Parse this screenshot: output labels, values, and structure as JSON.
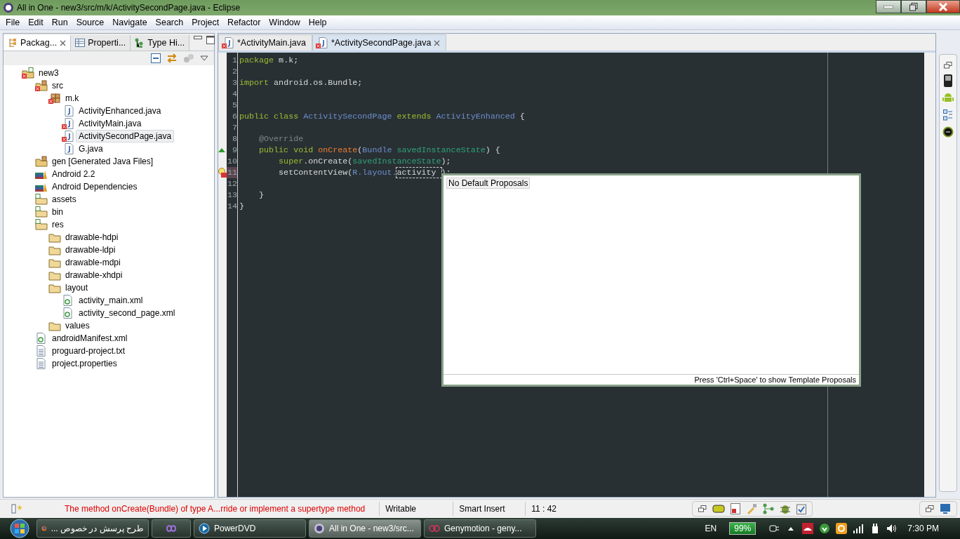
{
  "window": {
    "title": "All in One - new3/src/m/k/ActivitySecondPage.java - Eclipse"
  },
  "menu": [
    "File",
    "Edit",
    "Run",
    "Source",
    "Navigate",
    "Search",
    "Project",
    "Refactor",
    "Window",
    "Help"
  ],
  "left_panel": {
    "tabs": [
      {
        "label": "Packag...",
        "selected": true,
        "kind": "package"
      },
      {
        "label": "Properti...",
        "selected": false,
        "kind": "table"
      },
      {
        "label": "Type Hi...",
        "selected": false,
        "kind": "hierarchy"
      }
    ],
    "tree": [
      {
        "label": "new3",
        "kind": "project",
        "error": true,
        "selected": false,
        "children": [
          {
            "label": "src",
            "kind": "source",
            "error": true,
            "selected": false,
            "children": [
              {
                "label": "m.k",
                "kind": "package",
                "error": true,
                "selected": false,
                "children": [
                  {
                    "label": "ActivityEnhanced.java",
                    "kind": "java",
                    "error": false,
                    "selected": false
                  },
                  {
                    "label": "ActivityMain.java",
                    "kind": "java",
                    "error": true,
                    "selected": false
                  },
                  {
                    "label": "ActivitySecondPage.java",
                    "kind": "java",
                    "error": true,
                    "selected": true
                  },
                  {
                    "label": "G.java",
                    "kind": "java",
                    "error": false,
                    "selected": false
                  }
                ]
              }
            ]
          },
          {
            "label": "gen [Generated Java Files]",
            "kind": "source",
            "error": false,
            "selected": false
          },
          {
            "label": "Android 2.2",
            "kind": "library",
            "error": false,
            "selected": false
          },
          {
            "label": "Android Dependencies",
            "kind": "library",
            "error": false,
            "selected": false
          },
          {
            "label": "assets",
            "kind": "pfolder",
            "error": false,
            "selected": false
          },
          {
            "label": "bin",
            "kind": "pfolder",
            "error": false,
            "selected": false
          },
          {
            "label": "res",
            "kind": "pfolder",
            "error": false,
            "selected": false,
            "children": [
              {
                "label": "drawable-hdpi",
                "kind": "folder",
                "error": false,
                "selected": false
              },
              {
                "label": "drawable-ldpi",
                "kind": "folder",
                "error": false,
                "selected": false
              },
              {
                "label": "drawable-mdpi",
                "kind": "folder",
                "error": false,
                "selected": false
              },
              {
                "label": "drawable-xhdpi",
                "kind": "folder",
                "error": false,
                "selected": false
              },
              {
                "label": "layout",
                "kind": "folder",
                "error": false,
                "selected": false,
                "children": [
                  {
                    "label": "activity_main.xml",
                    "kind": "xml",
                    "error": false,
                    "selected": false
                  },
                  {
                    "label": "activity_second_page.xml",
                    "kind": "xml",
                    "error": false,
                    "selected": false
                  }
                ]
              },
              {
                "label": "values",
                "kind": "folder",
                "error": false,
                "selected": false
              }
            ]
          },
          {
            "label": "androidManifest.xml",
            "kind": "xml",
            "error": false,
            "selected": false
          },
          {
            "label": "proguard-project.txt",
            "kind": "text",
            "error": false,
            "selected": false
          },
          {
            "label": "project.properties",
            "kind": "text",
            "error": false,
            "selected": false
          }
        ]
      }
    ]
  },
  "editor": {
    "tabs": [
      {
        "label": "*ActivityMain.java",
        "selected": false,
        "error": true
      },
      {
        "label": "*ActivitySecondPage.java",
        "selected": true,
        "error": true
      }
    ],
    "lines": [
      {
        "number": "1",
        "override": false,
        "error": false,
        "tokens": [
          {
            "text": "package",
            "kind": "keyword"
          },
          {
            "text": " m.k;",
            "kind": "plain"
          }
        ]
      },
      {
        "number": "2",
        "override": false,
        "error": false
      },
      {
        "number": "3",
        "override": false,
        "error": false,
        "tokens": [
          {
            "text": "import",
            "kind": "keyword"
          },
          {
            "text": " android.os.Bundle;",
            "kind": "plain"
          }
        ]
      },
      {
        "number": "4",
        "override": false,
        "error": false
      },
      {
        "number": "5",
        "override": false,
        "error": false
      },
      {
        "number": "6",
        "override": false,
        "error": false,
        "tokens": [
          {
            "text": "public class",
            "kind": "keyword"
          },
          {
            "text": " ActivitySecondPage",
            "kind": "type"
          },
          {
            "text": " extends",
            "kind": "keyword"
          },
          {
            "text": " ActivityEnhanced",
            "kind": "type"
          },
          {
            "text": " {",
            "kind": "plain"
          }
        ]
      },
      {
        "number": "7",
        "override": false,
        "error": false
      },
      {
        "number": "8",
        "override": false,
        "error": false,
        "tokens": [
          {
            "text": "    @Override",
            "kind": "annotation"
          }
        ]
      },
      {
        "number": "9",
        "override": true,
        "error": false,
        "tokens": [
          {
            "text": "    public void",
            "kind": "keyword"
          },
          {
            "text": " onCreate",
            "kind": "method"
          },
          {
            "text": "(",
            "kind": "plain"
          },
          {
            "text": "Bundle",
            "kind": "type"
          },
          {
            "text": " savedInstanceState",
            "kind": "param"
          },
          {
            "text": ") {",
            "kind": "plain"
          }
        ]
      },
      {
        "number": "10",
        "override": false,
        "error": false,
        "tokens": [
          {
            "text": "        super",
            "kind": "keyword"
          },
          {
            "text": ".onCreate(",
            "kind": "plain"
          },
          {
            "text": "savedInstanceState",
            "kind": "param"
          },
          {
            "text": ");",
            "kind": "plain"
          }
        ]
      },
      {
        "number": "11",
        "override": false,
        "error": true,
        "tokens": [
          {
            "text": "        setContentView(",
            "kind": "plain"
          },
          {
            "text": "R.layout.",
            "kind": "type"
          },
          {
            "text": "activity ",
            "kind": "linked"
          },
          {
            "text": ");",
            "kind": "plain"
          }
        ]
      },
      {
        "number": "12",
        "override": false,
        "error": false
      },
      {
        "number": "13",
        "override": false,
        "error": false,
        "tokens": [
          {
            "text": "    }",
            "kind": "plain"
          }
        ]
      },
      {
        "number": "14",
        "override": false,
        "error": false,
        "tokens": [
          {
            "text": "}",
            "kind": "plain"
          }
        ]
      }
    ]
  },
  "proposals": {
    "message": "No Default Proposals",
    "footer": "Press 'Ctrl+Space' to show Template Proposals"
  },
  "status_bar": {
    "message": "The method onCreate(Bundle) of type A...rride or implement a supertype method",
    "writable": "Writable",
    "insert_mode": "Smart Insert",
    "position": "11 : 42"
  },
  "taskbar": {
    "items": [
      {
        "label": "طرح پرسش در خصوص ...",
        "kind": "firefox",
        "selected": false
      },
      {
        "kind": "studio",
        "selected": false
      },
      {
        "label": "PowerDVD",
        "kind": "dvd",
        "selected": false
      },
      {
        "label": "All in One - new3/src...",
        "kind": "eclipse",
        "selected": true
      },
      {
        "label": "Genymotion - geny...",
        "kind": "geny",
        "selected": false
      }
    ],
    "language": "EN",
    "battery": "99%",
    "clock": "7:30 PM"
  }
}
